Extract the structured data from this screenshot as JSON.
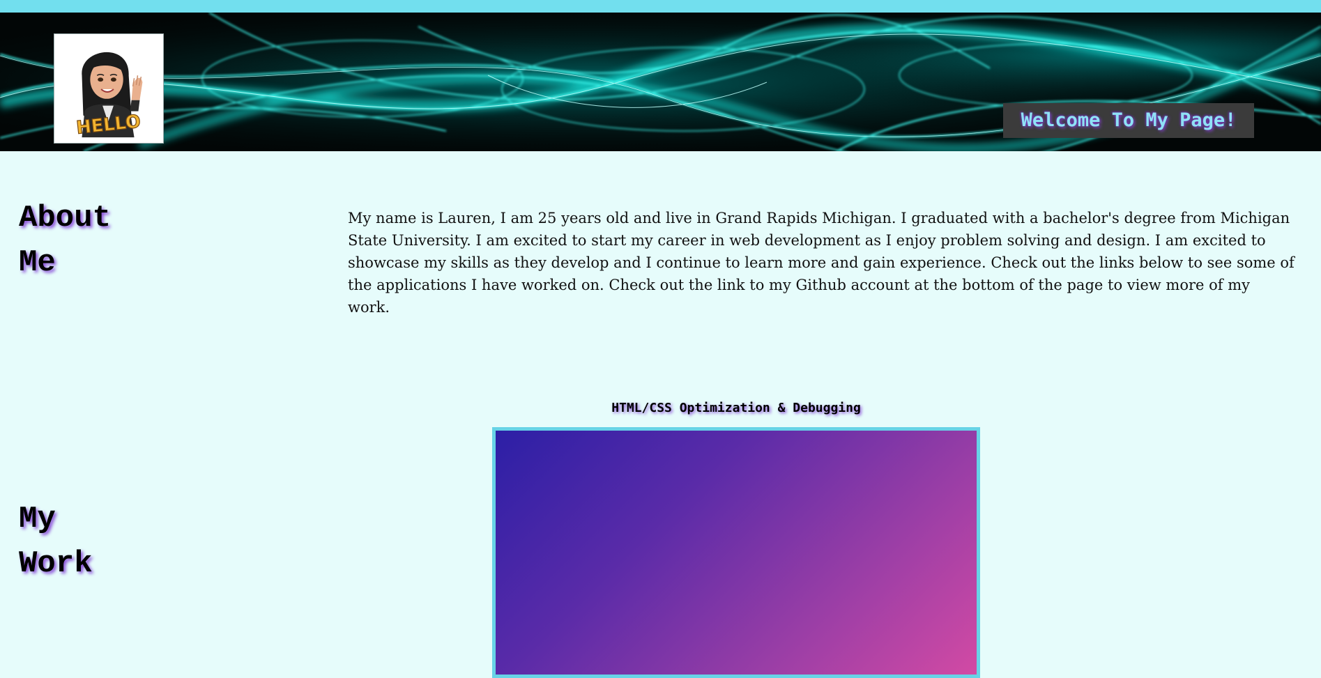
{
  "header": {
    "avatar_caption": "HELLO",
    "welcome_text": "Welcome To My Page!"
  },
  "about": {
    "heading_line1": "About",
    "heading_line2": "Me",
    "text": "My name is Lauren, I am 25 years old and live in Grand Rapids Michigan. I graduated with a bachelor's degree from Michigan State University. I am excited to start my career in web development as I enjoy problem solving and design. I am excited to showcase my skills as they develop and I continue to learn more and gain experience. Check out the links below to see some of the applications I have worked on. Check out the link to my Github account at the bottom of the page to view more of my work."
  },
  "work": {
    "heading_line1": "My",
    "heading_line2": "Work",
    "projects": [
      {
        "title": "HTML/CSS Optimization & Debugging"
      }
    ]
  },
  "colors": {
    "page_background": "#e6fcfb",
    "top_strip": "#72dfee",
    "accent_cyan": "#67d3e6",
    "heading_shadow": "#8a4fd8",
    "welcome_bg": "#3b3b3b",
    "welcome_text": "#8fe2f6"
  }
}
